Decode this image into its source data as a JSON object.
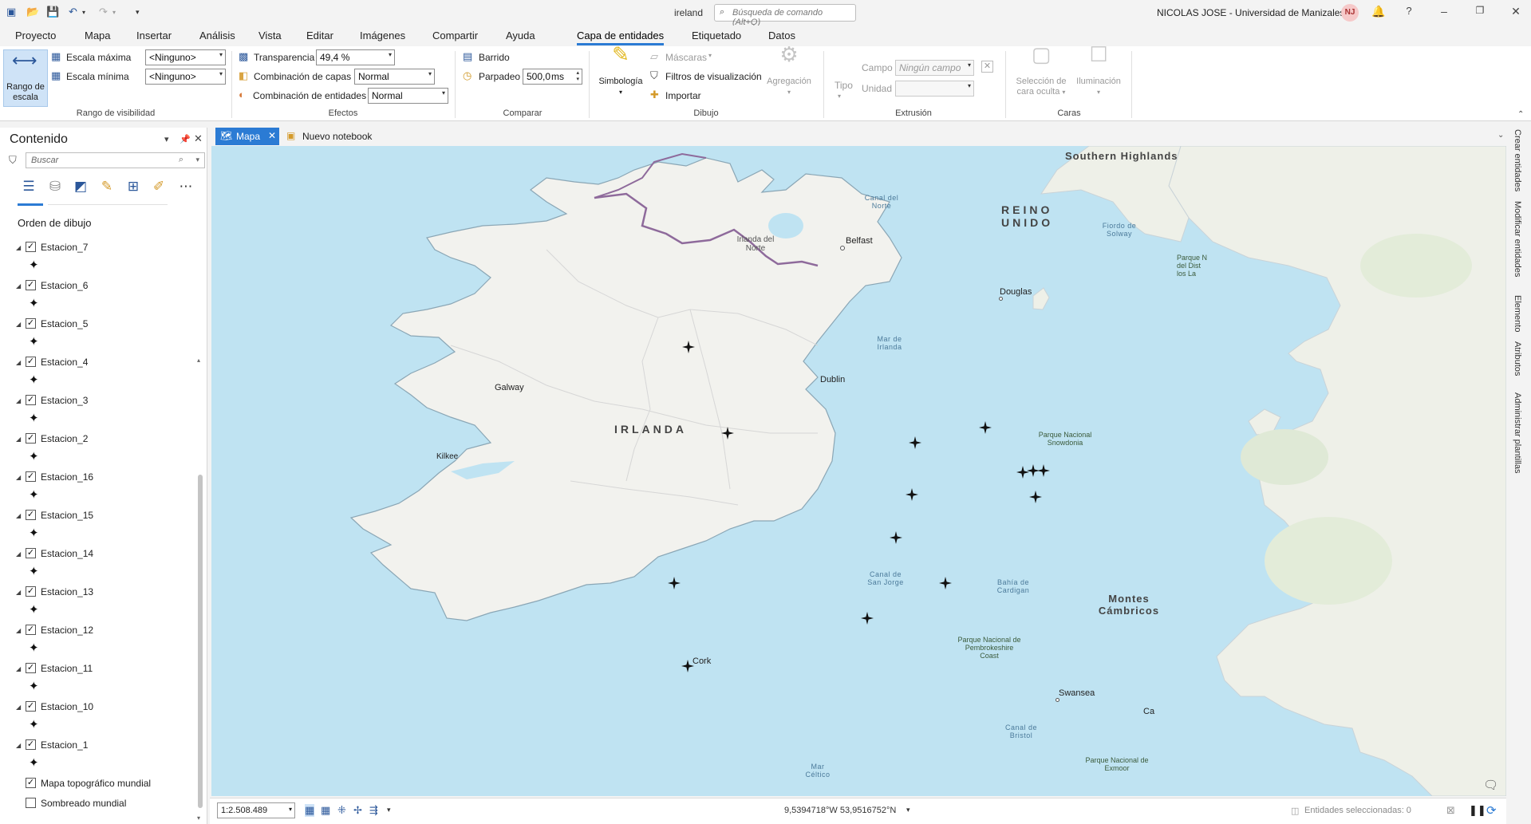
{
  "titlebar": {
    "project_name": "ireland",
    "command_search_placeholder": "Búsqueda de comando (Alt+Q)",
    "user": "NICOLAS JOSE - Universidad de Manizales",
    "avatar_initials": "NJ"
  },
  "ribbon_tabs": [
    "Proyecto",
    "Mapa",
    "Insertar",
    "Análisis",
    "Vista",
    "Editar",
    "Imágenes",
    "Compartir",
    "Ayuda",
    "Capa de entidades",
    "Etiquetado",
    "Datos"
  ],
  "ribbon_active_tab": "Capa de entidades",
  "ribbon": {
    "visibility": {
      "scale_range_button": "Rango de escala",
      "max_scale_label": "Escala máxima",
      "max_scale_value": "<Ninguno>",
      "min_scale_label": "Escala mínima",
      "min_scale_value": "<Ninguno>",
      "group_label": "Rango de visibilidad"
    },
    "effects": {
      "transparency_label": "Transparencia",
      "transparency_value": "49,4 %",
      "layer_blend_label": "Combinación de capas",
      "layer_blend_value": "Normal",
      "feature_blend_label": "Combinación de entidades",
      "feature_blend_value": "Normal",
      "group_label": "Efectos"
    },
    "compare": {
      "swipe_label": "Barrido",
      "flicker_label": "Parpadeo",
      "flicker_value": "500,0",
      "flicker_unit": "ms",
      "group_label": "Comparar"
    },
    "drawing": {
      "symbology_label": "Simbología",
      "masks_label": "Máscaras",
      "display_filters_label": "Filtros de visualización",
      "import_label": "Importar",
      "aggregation_label": "Agregación",
      "group_label": "Dibujo"
    },
    "extrusion": {
      "type_label": "Tipo",
      "field_label": "Campo",
      "field_value": "Ningún campo",
      "unit_label": "Unidad",
      "group_label": "Extrusión"
    },
    "faces": {
      "backface_label": "Selección de cara oculta",
      "lighting_label": "Iluminación",
      "group_label": "Caras"
    }
  },
  "contents": {
    "title": "Contenido",
    "search_placeholder": "Buscar",
    "section_title": "Orden de dibujo",
    "layers": [
      {
        "name": "Estacion_7",
        "checked": true
      },
      {
        "name": "Estacion_6",
        "checked": true
      },
      {
        "name": "Estacion_5",
        "checked": true
      },
      {
        "name": "Estacion_4",
        "checked": true
      },
      {
        "name": "Estacion_3",
        "checked": true
      },
      {
        "name": "Estacion_2",
        "checked": true
      },
      {
        "name": "Estacion_16",
        "checked": true
      },
      {
        "name": "Estacion_15",
        "checked": true
      },
      {
        "name": "Estacion_14",
        "checked": true
      },
      {
        "name": "Estacion_13",
        "checked": true
      },
      {
        "name": "Estacion_12",
        "checked": true
      },
      {
        "name": "Estacion_11",
        "checked": true
      },
      {
        "name": "Estacion_10",
        "checked": true
      },
      {
        "name": "Estacion_1",
        "checked": true
      }
    ],
    "basemaps": [
      {
        "name": "Mapa topográfico mundial",
        "checked": true
      },
      {
        "name": "Sombreado mundial",
        "checked": false
      }
    ]
  },
  "view_tabs": [
    {
      "label": "Mapa",
      "active": true
    },
    {
      "label": "Nuevo notebook",
      "active": false
    }
  ],
  "map_labels": {
    "southern_highlands": "Southern Highlands",
    "reino_unido": "REINO UNIDO",
    "canal_norte": "Canal del Norte",
    "irlanda_norte": "Irlanda del Norte",
    "belfast": "Belfast",
    "fiordo_solway": "Fiordo de Solway",
    "parque_lake": "Parque N del Dist los La",
    "douglas": "Douglas",
    "mar_irlanda": "Mar de Irlanda",
    "dublin": "Dublin",
    "galway": "Galway",
    "irlanda": "IRLANDA",
    "kilkee": "Kilkee",
    "snowdonia": "Parque Nacional Snowdonia",
    "canal_san_jorge": "Canal de San Jorge",
    "bahia_cardigan": "Bahía de Cardigan",
    "montes_cambricos": "Montes Cámbricos",
    "pembrokeshire": "Parque Nacional de Pembrokeshire Coast",
    "cork": "Cork",
    "swansea": "Swansea",
    "cardiff_partial": "Ca",
    "canal_bristol": "Canal de Bristol",
    "exmoor": "Parque Nacional de Exmoor",
    "mar_celtico": "Mar Céltico"
  },
  "side_panes": [
    "Crear entidades",
    "Modificar entidades",
    "Elemento",
    "Atributos",
    "Administrar plantillas"
  ],
  "statusbar": {
    "scale": "1:2.508.489",
    "coordinates": "9,5394718°W 53,9516752°N",
    "selected_features": "Entidades seleccionadas: 0"
  },
  "colors": {
    "accent": "#2b7bd4",
    "water": "#bfe3f2",
    "land": "#f2f2ee",
    "border_ni": "#8e6a9b"
  },
  "icons": {
    "station_symbol": "four-point-star-icon"
  }
}
